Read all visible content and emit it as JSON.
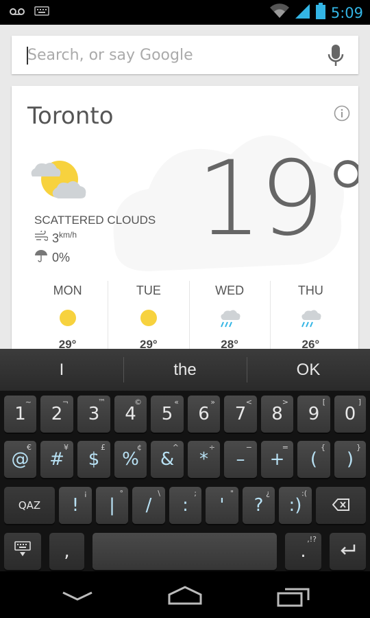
{
  "status_bar": {
    "time": "5:09",
    "icons": [
      "voicemail-icon",
      "keyboard-icon",
      "wifi-icon",
      "signal-icon",
      "battery-icon"
    ]
  },
  "search": {
    "placeholder": "Search, or say Google"
  },
  "weather": {
    "city": "Toronto",
    "temperature": "19°",
    "condition": "SCATTERED CLOUDS",
    "wind_value": "3",
    "wind_unit": "km/h",
    "precipitation": "0%",
    "forecast": [
      {
        "day": "MON",
        "icon": "sun-icon",
        "temp": "29°"
      },
      {
        "day": "TUE",
        "icon": "sun-icon",
        "temp": "29°"
      },
      {
        "day": "WED",
        "icon": "rain-cloud-icon",
        "temp": "28°"
      },
      {
        "day": "THU",
        "icon": "rain-cloud-icon",
        "temp": "26°"
      }
    ]
  },
  "keyboard": {
    "suggestions": [
      "I",
      "the",
      "OK"
    ],
    "row1": [
      {
        "label": "1",
        "hint": "~"
      },
      {
        "label": "2",
        "hint": "¬"
      },
      {
        "label": "3",
        "hint": "™"
      },
      {
        "label": "4",
        "hint": "©"
      },
      {
        "label": "5",
        "hint": "«"
      },
      {
        "label": "6",
        "hint": "»"
      },
      {
        "label": "7",
        "hint": "<"
      },
      {
        "label": "8",
        "hint": ">"
      },
      {
        "label": "9",
        "hint": "["
      },
      {
        "label": "0",
        "hint": "]"
      }
    ],
    "row2": [
      {
        "label": "@",
        "hint": "€"
      },
      {
        "label": "#",
        "hint": "¥"
      },
      {
        "label": "$",
        "hint": "£"
      },
      {
        "label": "%",
        "hint": "¢"
      },
      {
        "label": "&",
        "hint": "^"
      },
      {
        "label": "*",
        "hint": "÷"
      },
      {
        "label": "–",
        "hint": "−"
      },
      {
        "label": "+",
        "hint": "="
      },
      {
        "label": "(",
        "hint": "{"
      },
      {
        "label": ")",
        "hint": "}"
      }
    ],
    "row3": [
      {
        "label": "!",
        "hint": "¡"
      },
      {
        "label": "|",
        "hint": "°"
      },
      {
        "label": "/",
        "hint": "\\"
      },
      {
        "label": ":",
        "hint": ";"
      },
      {
        "label": "'",
        "hint": "\""
      },
      {
        "label": "?",
        "hint": "¿"
      },
      {
        "label": ":)",
        "hint": ":("
      }
    ],
    "abc_label": "QAZ",
    "comma_label": ",",
    "period_label": ".",
    "period_hint": ",!?"
  },
  "colors": {
    "accent": "#33b5e5",
    "sun": "#f7d23e",
    "cloud": "#cfd3d6",
    "rain": "#33b5e5"
  }
}
